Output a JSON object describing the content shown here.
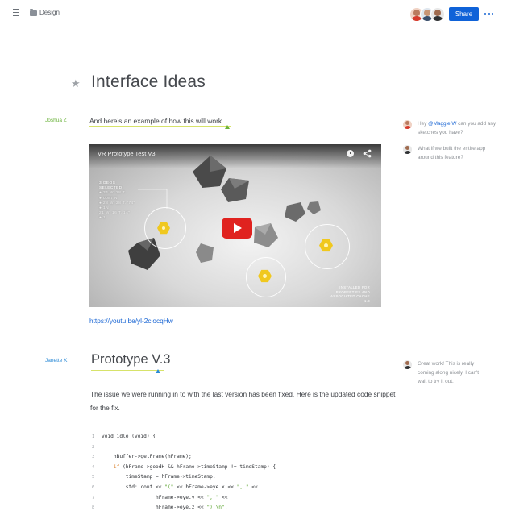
{
  "header": {
    "folder_name": "Design",
    "share_label": "Share"
  },
  "doc": {
    "title": "Interface Ideas",
    "sections": [
      {
        "author": "Joshua Z",
        "author_color": "#6ab23a",
        "text": "And here's an example of how this will work."
      },
      {
        "author": "Janette K",
        "author_color": "#2b8ad6",
        "title": "Prototype V.3",
        "text": "The issue we were running in to with the last version has been fixed. Here is the updated code snippet for the fix."
      }
    ],
    "video": {
      "title": "VR Prototype Test V3",
      "info_lines": [
        "3 GEOS",
        "SELECTED",
        "● 34 W. 28 T.",
        "● 0087 N",
        "● 28 W. 28 T. '74\"",
        "● 1N",
        "21 W. 16 T. 14\"",
        "● 1"
      ],
      "bottom_note": [
        "INSTALLED FOR",
        "PROPERTIES AND",
        "ASSOCIATED CACHE",
        "1.3"
      ],
      "link": "https://youtu.be/yl-2clocqHw"
    }
  },
  "comments": [
    {
      "prefix": "Hey ",
      "mention": "@Maggie W",
      "suffix": " can you add any sketches you have?",
      "lines": [
        "Hey @Maggie W can you add",
        "any sketches you have?"
      ]
    },
    {
      "lines": [
        "What if we built the entire app",
        "around this feature?"
      ]
    },
    {
      "lines": [
        "Great work! This is really",
        "coming along nicely. I can't",
        "wait to try it out."
      ]
    }
  ],
  "code": [
    {
      "n": "1",
      "text": "void idle (void) {"
    },
    {
      "n": "2",
      "text": ""
    },
    {
      "n": "3",
      "text": "    hBuffer->getFrame(hFrame);"
    },
    {
      "n": "4",
      "kw": "if",
      "text": " (hFrame->goodH && hFrame->timeStamp != timeStamp) {"
    },
    {
      "n": "5",
      "text": "        timeStamp = hFrame->timeStamp;"
    },
    {
      "n": "6",
      "pre": "        std::cout << ",
      "str": "\"(\"",
      "post": " << hFrame->eye.x << ",
      "str2": "\", \"",
      "post2": " <<"
    },
    {
      "n": "7",
      "pre": "                  hFrame->eye.y << ",
      "str": "\", \"",
      "post": " <<"
    },
    {
      "n": "8",
      "pre": "                  hFrame->eye.z << ",
      "str": "\") \\n\"",
      "post": ";"
    }
  ],
  "colors": {
    "accent": "#0f62d8",
    "highlight": "#d7e36a"
  }
}
